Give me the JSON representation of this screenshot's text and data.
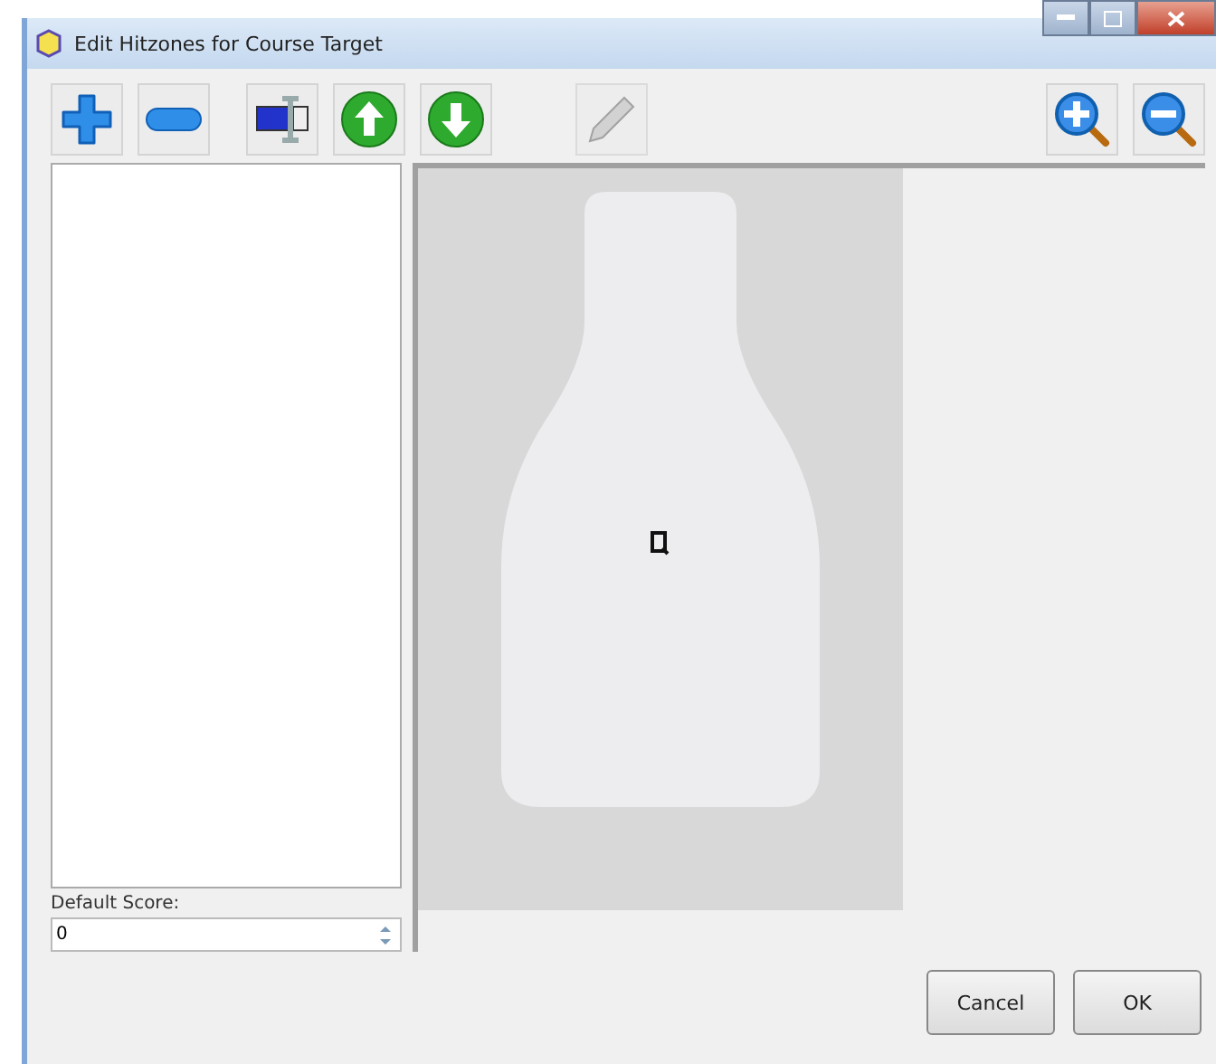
{
  "window": {
    "title": "Edit Hitzones for Course Target"
  },
  "toolbar": {
    "left": [
      {
        "kind": "add",
        "disabled": false
      },
      {
        "kind": "remove",
        "disabled": false
      },
      {
        "kind": "rename",
        "disabled": false
      },
      {
        "kind": "up",
        "disabled": false
      },
      {
        "kind": "down",
        "disabled": false
      },
      {
        "kind": "edit",
        "disabled": true
      }
    ],
    "right": [
      {
        "kind": "zoom_in",
        "disabled": false
      },
      {
        "kind": "zoom_out",
        "disabled": false
      }
    ]
  },
  "default_score": {
    "label": "Default Score:",
    "value": "0"
  },
  "buttons": [
    "Cancel",
    "OK"
  ]
}
